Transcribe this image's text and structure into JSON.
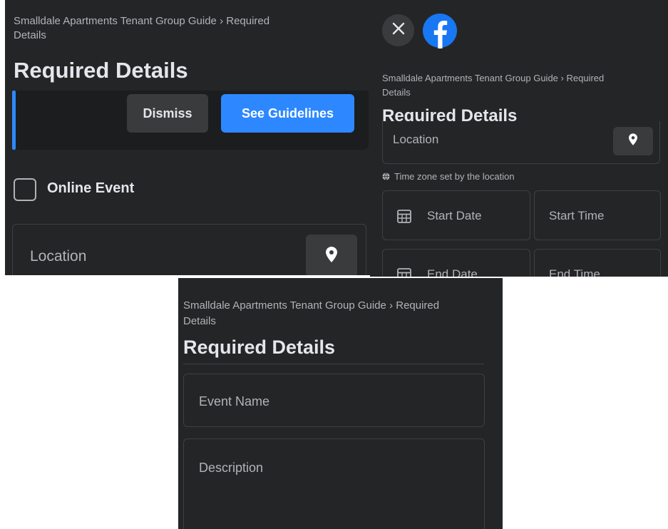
{
  "breadcrumb": {
    "group": "Smalldale Apartments Tenant Group Guide",
    "separator": "›",
    "current": "Required",
    "current_wrap": "Details"
  },
  "page_title": "Required Details",
  "banner": {
    "dismiss_label": "Dismiss",
    "guidelines_label": "See Guidelines"
  },
  "online_event": {
    "label": "Online Event",
    "checked": false
  },
  "location": {
    "placeholder": "Location",
    "icon": "map-pin-icon"
  },
  "timezone_note": "Time zone set by the location",
  "start_date": {
    "placeholder": "Start Date",
    "icon": "calendar-icon"
  },
  "start_time": {
    "placeholder": "Start Time"
  },
  "end_date": {
    "placeholder": "End Date",
    "icon": "calendar-icon"
  },
  "end_time": {
    "placeholder": "End Time"
  },
  "event_name": {
    "placeholder": "Event Name"
  },
  "description": {
    "placeholder": "Description"
  },
  "header_icons": [
    "close-icon",
    "facebook-logo-icon"
  ],
  "colors": {
    "panel_bg": "#242526",
    "field_border": "#3e4042",
    "text_primary": "#e4e6eb",
    "text_secondary": "#b0b3b8",
    "accent": "#2d88ff",
    "button_secondary_bg": "#3a3b3c"
  }
}
